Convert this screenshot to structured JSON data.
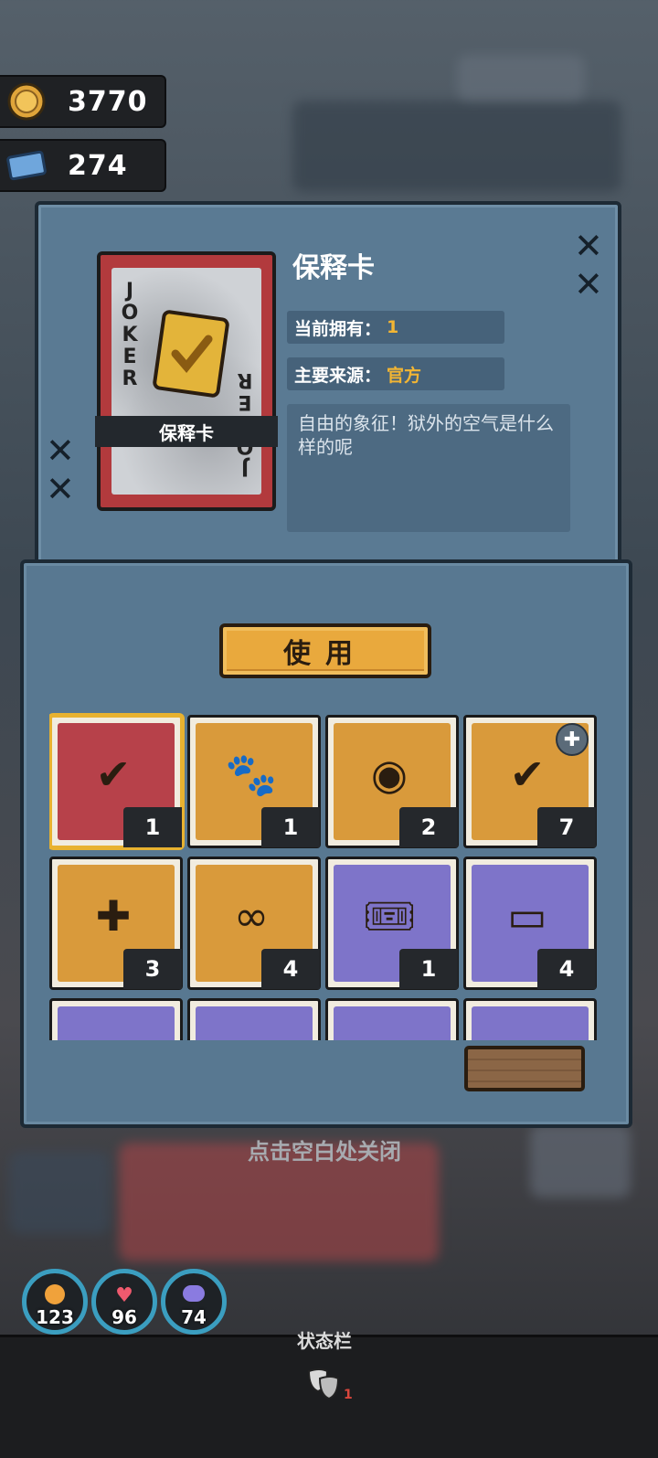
{
  "currencies": [
    {
      "icon": "gold-coin-icon",
      "value": "3770"
    },
    {
      "icon": "blue-ticket-icon",
      "value": "274"
    }
  ],
  "item": {
    "card_letters": "JOKER",
    "card_label": "保释卡",
    "title": "保释卡",
    "owned_label": "当前拥有：",
    "owned_value": "1",
    "source_label": "主要来源：",
    "source_value": "官方",
    "description": "自由的象征！狱外的空气是什么样的呢"
  },
  "use_button": "使用",
  "inventory": [
    {
      "name": "bail-card",
      "bg": "#b7414a",
      "count": "1",
      "selected": true,
      "icon": "gold-check-card-icon"
    },
    {
      "name": "paw-map",
      "bg": "#d99a3b",
      "count": "1",
      "icon": "paw-print-scroll-icon"
    },
    {
      "name": "film-reel",
      "bg": "#d99a3b",
      "count": "2",
      "icon": "film-reel-icon"
    },
    {
      "name": "gold-card-plus",
      "bg": "#d99a3b",
      "count": "7",
      "icon": "gold-check-card-icon",
      "badge": "puzzle-icon"
    },
    {
      "name": "medical-card",
      "bg": "#d99a3b",
      "count": "3",
      "icon": "medical-card-icon"
    },
    {
      "name": "gold-loop-card",
      "bg": "#d99a3b",
      "count": "4",
      "icon": "gold-loop-card-icon"
    },
    {
      "name": "toy-ticket",
      "bg": "#7e74c9",
      "count": "1",
      "icon": "toy-ticket-icon"
    },
    {
      "name": "blue-ticket",
      "bg": "#7e74c9",
      "count": "4",
      "icon": "blue-ticket-icon"
    },
    {
      "name": "partial-1",
      "bg": "#7e74c9",
      "count": "",
      "icon": "red-item-icon"
    },
    {
      "name": "partial-2",
      "bg": "#7e74c9",
      "count": "",
      "icon": "green-ticket-icon"
    },
    {
      "name": "partial-3",
      "bg": "#7e74c9",
      "count": "",
      "icon": "blue-item-icon"
    },
    {
      "name": "partial-4",
      "bg": "#7e74c9",
      "count": "",
      "icon": "cards-icon"
    }
  ],
  "close_hint": "点击空白处关闭",
  "stats": [
    {
      "icon": "hunger-icon",
      "value": "123",
      "color": "#f0a23b"
    },
    {
      "icon": "heart-icon",
      "value": "96",
      "color": "#ef5a6e"
    },
    {
      "icon": "brain-icon",
      "value": "74",
      "color": "#8a7be0"
    }
  ],
  "status_bar": {
    "label": "状态栏",
    "mask_count": "1"
  },
  "colors": {
    "accent_gold": "#e9a93d",
    "panel_blue": "#587891"
  }
}
